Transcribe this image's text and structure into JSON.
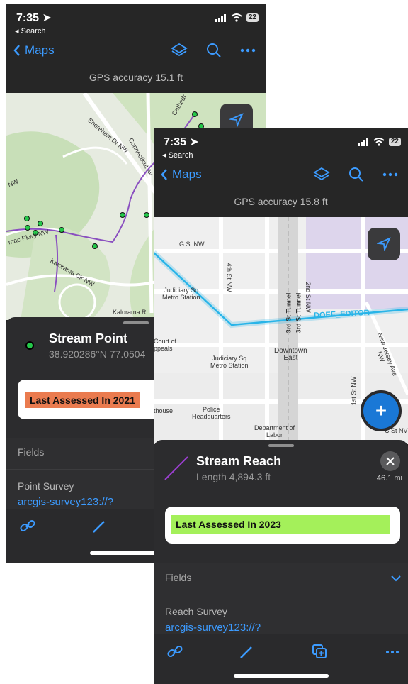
{
  "screen_back": {
    "status": {
      "time": "7:35",
      "back_label": "◂ Search",
      "battery": "22"
    },
    "nav": {
      "back_label": "Maps"
    },
    "gps_text": "GPS accuracy 15.1 ft",
    "map_labels": {
      "shoreham": "Shoreham Dr NW",
      "connecticut": "Connecticut Av",
      "cathedral": "Cathedr",
      "nw": "NW",
      "parkway": "mac Pkwy NW",
      "kalorama_cir": "Kalorama Cir NW",
      "kalorama": "Kalorama R"
    },
    "feature": {
      "title": "Stream Point",
      "coords": "38.920286°N  77.0504"
    },
    "assessed_label": "Last Assessed In 2021",
    "assessed_color": "#ea7b4f",
    "fields_label": "Fields",
    "survey_label": "Point Survey",
    "survey_link": "arcgis-survey123://?"
  },
  "screen_front": {
    "status": {
      "time": "7:35",
      "back_label": "◂ Search",
      "battery": "22"
    },
    "nav": {
      "back_label": "Maps"
    },
    "gps_text": "GPS accuracy 15.8 ft",
    "map_labels": {
      "g_st": "G St NW",
      "fourth_st": "4th St NW",
      "second_st": "2nd St NW",
      "third_tunnel_a": "3rd St Tunnel",
      "third_tunnel_b": "3rd St Tunnel",
      "judiciary_station": "Judiciary Sq\nMetro Station",
      "doee": "DOEE_EDITOR",
      "nj_ave": "New Jersey Ave NW",
      "court": "Court of\nppeals",
      "judiciary_station2": "Judiciary Sq\nMetro Station",
      "downtown": "Downtown\nEast",
      "first_st": "1st St NW",
      "house": "thouse",
      "police": "Police\nHeadquarters",
      "labor": "Department of\nLabor",
      "c_st": "C St NV"
    },
    "feature": {
      "title": "Stream Reach",
      "length": "Length 4,894.3 ft",
      "distance": "46.1 mi"
    },
    "assessed_label": "Last Assessed In 2023",
    "assessed_color": "#a4f05a",
    "fields_label": "Fields",
    "survey_label": "Reach Survey",
    "survey_link": "arcgis-survey123://?"
  },
  "icons": {
    "layers": "layers-icon",
    "search": "search-icon",
    "more": "more-icon",
    "locate": "location-arrow-icon",
    "link": "link-icon",
    "pencil": "pencil-icon",
    "add": "add-icon",
    "close": "close-icon",
    "copy": "copy-add-icon",
    "chevron": "chevron-down-icon"
  }
}
